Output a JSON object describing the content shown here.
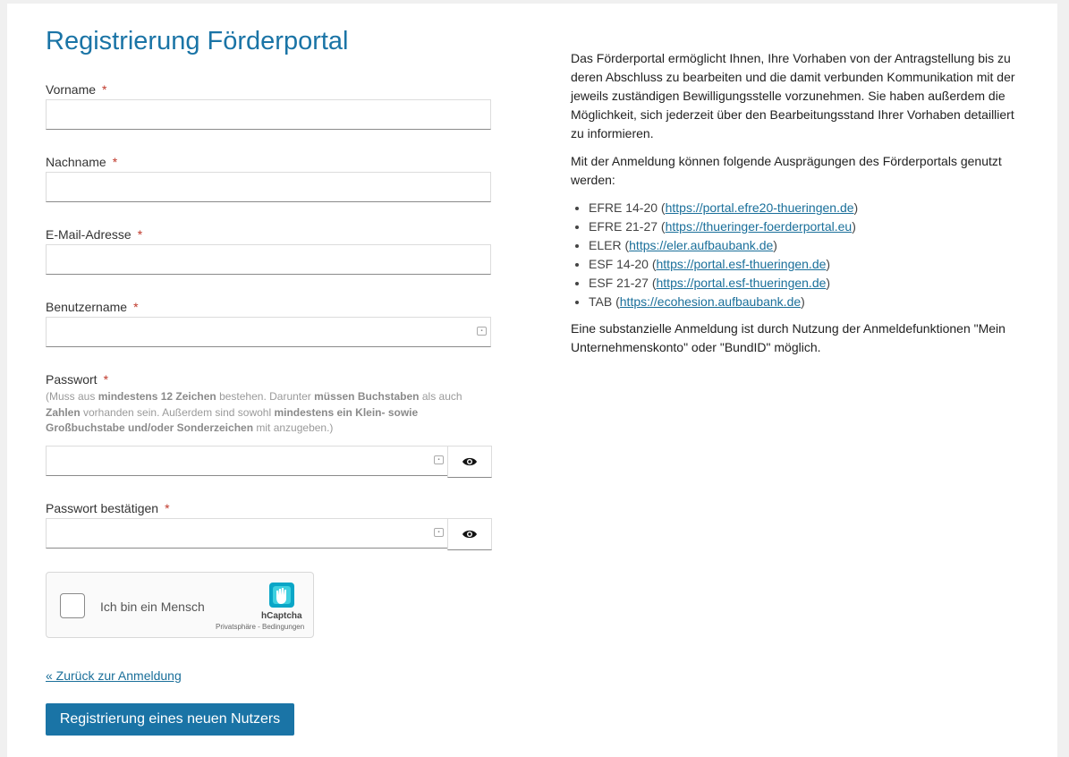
{
  "page": {
    "title": "Registrierung Förderportal"
  },
  "form": {
    "required_mark": "*",
    "fields": {
      "vorname": {
        "label": "Vorname",
        "value": ""
      },
      "nachname": {
        "label": "Nachname",
        "value": ""
      },
      "email": {
        "label": "E-Mail-Adresse",
        "value": ""
      },
      "benutzername": {
        "label": "Benutzername",
        "value": ""
      },
      "passwort": {
        "label": "Passwort",
        "value": ""
      },
      "passwort_bestaetigen": {
        "label": "Passwort bestätigen",
        "value": ""
      }
    },
    "password_hint": {
      "p1": "(Muss aus ",
      "b1": "mindestens 12 Zeichen",
      "p2": " bestehen. Darunter ",
      "b2": "müssen Buchstaben",
      "p3": " als auch ",
      "b3": "Zahlen",
      "p4": " vorhanden sein. Außerdem sind sowohl ",
      "b4": "mindestens ein Klein- sowie Großbuchstabe und/oder Sonderzeichen",
      "p5": " mit anzugeben.)"
    },
    "captcha": {
      "label": "Ich bin ein Mensch",
      "brand": "hCaptcha",
      "links": "Privatsphäre - Bedingungen"
    },
    "back_link": "« Zurück zur Anmeldung",
    "submit_label": "Registrierung eines neuen Nutzers"
  },
  "info": {
    "intro": "Das Förderportal ermöglicht Ihnen, Ihre Vorhaben von der Antragstellung bis zu deren Abschluss zu bearbeiten und die damit verbunden Kommunikation mit der jeweils zuständigen Bewilligungsstelle vorzunehmen. Sie haben außerdem die Möglichkeit, sich jederzeit über den Bearbeitungsstand Ihrer Vorhaben detailliert zu informieren.",
    "list_intro": "Mit der Anmeldung können folgende Ausprägungen des Förderportals genutzt werden:",
    "portals": [
      {
        "name": "EFRE 14-20",
        "url": "https://portal.efre20-thueringen.de"
      },
      {
        "name": "EFRE 21-27",
        "url": "https://thueringer-foerderportal.eu"
      },
      {
        "name": "ELER",
        "url": "https://eler.aufbaubank.de"
      },
      {
        "name": "ESF 14-20",
        "url": "https://portal.esf-thueringen.de"
      },
      {
        "name": "ESF 21-27",
        "url": "https://portal.esf-thueringen.de"
      },
      {
        "name": "TAB",
        "url": "https://ecohesion.aufbaubank.de"
      }
    ],
    "outro": "Eine substanzielle Anmeldung ist durch Nutzung der Anmeldefunktionen \"Mein Unternehmenskonto\" oder \"BundID\" möglich."
  },
  "colors": {
    "accent": "#1a74a6",
    "required": "#c0392b",
    "link": "#1a6f9a"
  }
}
